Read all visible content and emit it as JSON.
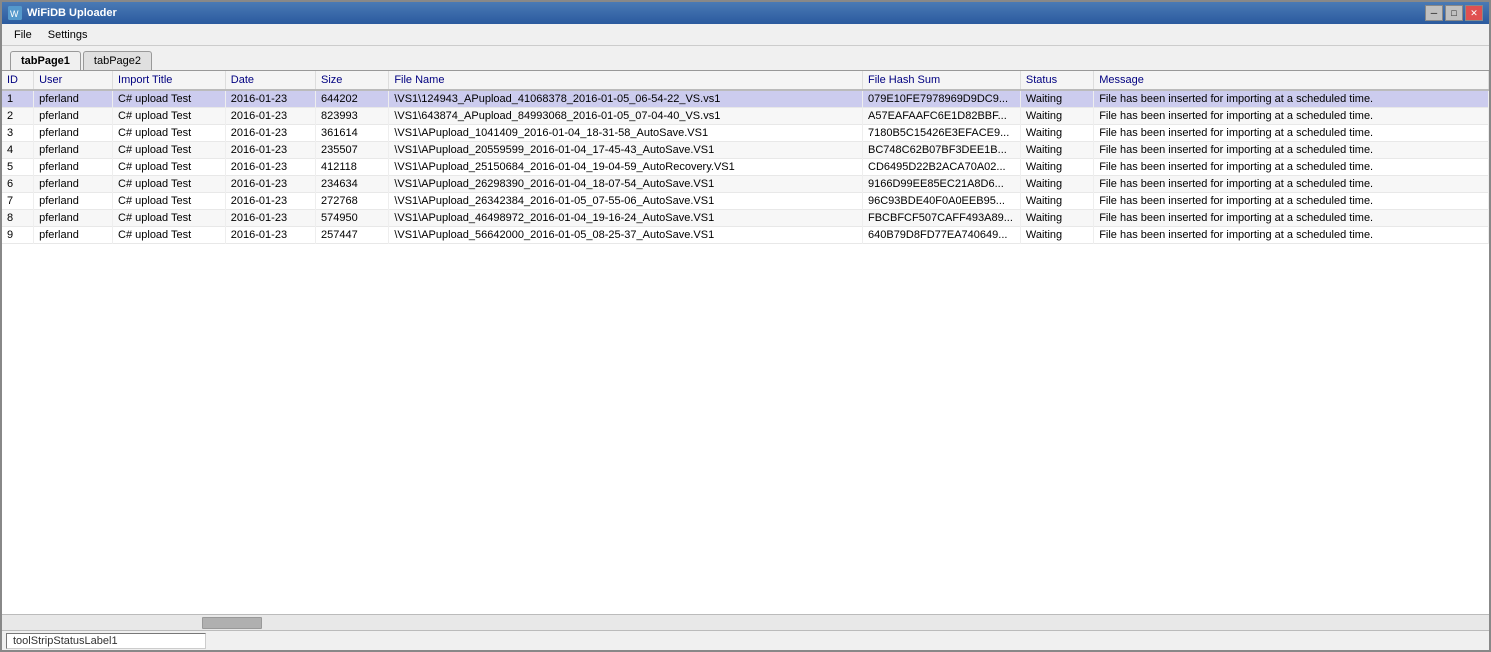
{
  "window": {
    "title": "WiFiDB Uploader",
    "title_icon": "wifi-icon"
  },
  "titlebar": {
    "minimize_label": "─",
    "maximize_label": "□",
    "close_label": "✕"
  },
  "menu": {
    "items": [
      {
        "label": "File",
        "id": "file"
      },
      {
        "label": "Settings",
        "id": "settings"
      }
    ]
  },
  "tabs": [
    {
      "label": "tabPage1",
      "id": "tab1",
      "active": true
    },
    {
      "label": "tabPage2",
      "id": "tab2",
      "active": false
    }
  ],
  "table": {
    "columns": [
      {
        "label": "ID",
        "key": "id"
      },
      {
        "label": "User",
        "key": "user"
      },
      {
        "label": "Import Title",
        "key": "import_title"
      },
      {
        "label": "Date",
        "key": "date"
      },
      {
        "label": "Size",
        "key": "size"
      },
      {
        "label": "File Name",
        "key": "file_name"
      },
      {
        "label": "File Hash Sum",
        "key": "hash"
      },
      {
        "label": "Status",
        "key": "status"
      },
      {
        "label": "Message",
        "key": "message"
      }
    ],
    "rows": [
      {
        "id": "1",
        "user": "pferland",
        "import_title": "C# upload Test",
        "date": "2016-01-23",
        "size": "644202",
        "file_name": "\\VS1\\124943_APupload_41068378_2016-01-05_06-54-22_VS.vs1",
        "hash": "079E10FE7978969D9DC9...",
        "status": "Waiting",
        "message": "File has been inserted for importing at a scheduled time."
      },
      {
        "id": "2",
        "user": "pferland",
        "import_title": "C# upload Test",
        "date": "2016-01-23",
        "size": "823993",
        "file_name": "\\VS1\\643874_APupload_84993068_2016-01-05_07-04-40_VS.vs1",
        "hash": "A57EAFAAFC6E1D82BBF...",
        "status": "Waiting",
        "message": "File has been inserted for importing at a scheduled time."
      },
      {
        "id": "3",
        "user": "pferland",
        "import_title": "C# upload Test",
        "date": "2016-01-23",
        "size": "361614",
        "file_name": "\\VS1\\APupload_1041409_2016-01-04_18-31-58_AutoSave.VS1",
        "hash": "7180B5C15426E3EFACE9...",
        "status": "Waiting",
        "message": "File has been inserted for importing at a scheduled time."
      },
      {
        "id": "4",
        "user": "pferland",
        "import_title": "C# upload Test",
        "date": "2016-01-23",
        "size": "235507",
        "file_name": "\\VS1\\APupload_20559599_2016-01-04_17-45-43_AutoSave.VS1",
        "hash": "BC748C62B07BF3DEE1B...",
        "status": "Waiting",
        "message": "File has been inserted for importing at a scheduled time."
      },
      {
        "id": "5",
        "user": "pferland",
        "import_title": "C# upload Test",
        "date": "2016-01-23",
        "size": "412118",
        "file_name": "\\VS1\\APupload_25150684_2016-01-04_19-04-59_AutoRecovery.VS1",
        "hash": "CD6495D22B2ACA70A02...",
        "status": "Waiting",
        "message": "File has been inserted for importing at a scheduled time."
      },
      {
        "id": "6",
        "user": "pferland",
        "import_title": "C# upload Test",
        "date": "2016-01-23",
        "size": "234634",
        "file_name": "\\VS1\\APupload_26298390_2016-01-04_18-07-54_AutoSave.VS1",
        "hash": "9166D99EE85EC21A8D6...",
        "status": "Waiting",
        "message": "File has been inserted for importing at a scheduled time."
      },
      {
        "id": "7",
        "user": "pferland",
        "import_title": "C# upload Test",
        "date": "2016-01-23",
        "size": "272768",
        "file_name": "\\VS1\\APupload_26342384_2016-01-05_07-55-06_AutoSave.VS1",
        "hash": "96C93BDE40F0A0EEB95...",
        "status": "Waiting",
        "message": "File has been inserted for importing at a scheduled time."
      },
      {
        "id": "8",
        "user": "pferland",
        "import_title": "C# upload Test",
        "date": "2016-01-23",
        "size": "574950",
        "file_name": "\\VS1\\APupload_46498972_2016-01-04_19-16-24_AutoSave.VS1",
        "hash": "FBCBFCF507CAFF493A89...",
        "status": "Waiting",
        "message": "File has been inserted for importing at a scheduled time."
      },
      {
        "id": "9",
        "user": "pferland",
        "import_title": "C# upload Test",
        "date": "2016-01-23",
        "size": "257447",
        "file_name": "\\VS1\\APupload_56642000_2016-01-05_08-25-37_AutoSave.VS1",
        "hash": "640B79D8FD77EA740649...",
        "status": "Waiting",
        "message": "File has been inserted for importing at a scheduled time."
      }
    ]
  },
  "statusbar": {
    "label": "toolStripStatusLabel1"
  }
}
